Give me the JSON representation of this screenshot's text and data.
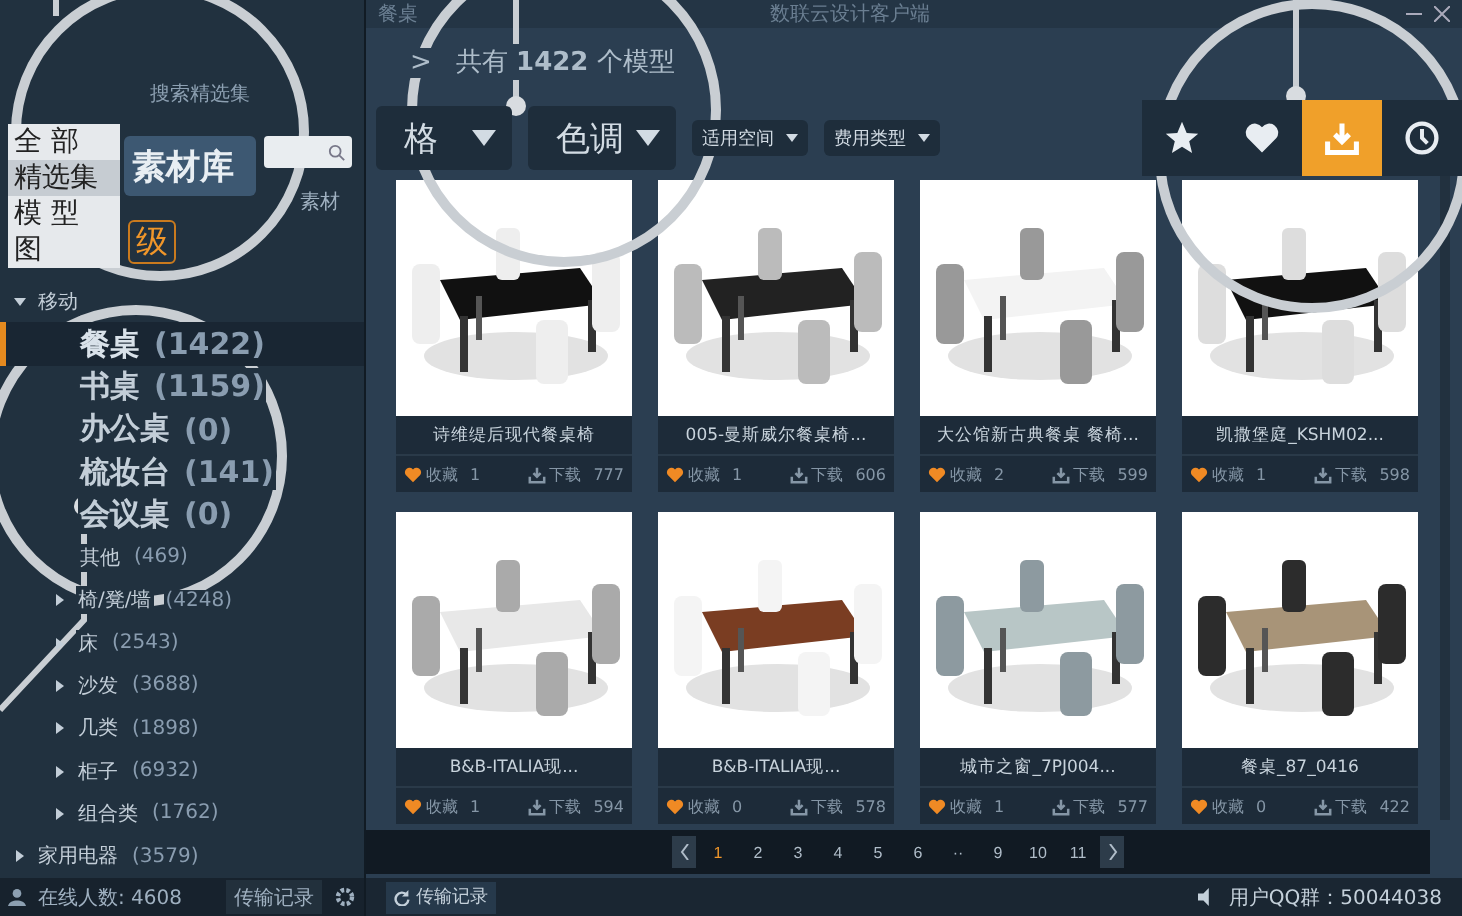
{
  "window": {
    "tab_label": "餐桌",
    "title": "数联云设计客户端"
  },
  "sidebar": {
    "search_label": "搜索精选集",
    "menu": [
      {
        "label": "全 部",
        "selected": false
      },
      {
        "label": "精选集",
        "selected": true
      },
      {
        "label": "模 型",
        "selected": false
      },
      {
        "label": "图",
        "selected": false
      }
    ],
    "library_button": "素材库",
    "tab": "素材",
    "level_badge": "级",
    "tree": [
      {
        "label": "移动",
        "expanded": true,
        "children": [
          {
            "label": "餐桌",
            "count": "(1422)",
            "selected": true,
            "magnified": true
          },
          {
            "label": "书桌",
            "count": "(1159)",
            "selected": false,
            "magnified": true
          },
          {
            "label": "办公桌",
            "count": "(0)",
            "selected": false,
            "magnified": true
          },
          {
            "label": "梳妆台",
            "count": "(141)",
            "selected": false,
            "magnified": true
          },
          {
            "label": "会议桌",
            "count": "(0)",
            "selected": false,
            "magnified": true
          },
          {
            "label": "其他",
            "count": "(469)",
            "selected": false,
            "magnified": false
          },
          {
            "label": "椅/凳/墙",
            "count": "(4248)",
            "selected": false,
            "magnified": false,
            "expanded": false
          },
          {
            "label": "床",
            "count": "(2543)",
            "selected": false,
            "magnified": false,
            "expanded": false
          },
          {
            "label": "沙发",
            "count": "(3688)",
            "selected": false,
            "magnified": false,
            "expanded": false
          },
          {
            "label": "几类",
            "count": "(1898)",
            "selected": false,
            "magnified": false,
            "expanded": false
          },
          {
            "label": "柜子",
            "count": "(6932)",
            "selected": false,
            "magnified": false,
            "expanded": false
          },
          {
            "label": "组合类",
            "count": "(1762)",
            "selected": false,
            "magnified": false,
            "expanded": false
          }
        ]
      },
      {
        "label": "家用电器",
        "count": "(3579)",
        "expanded": false
      }
    ],
    "footer": {
      "online": "在线人数: 4608",
      "transfer": "传输记录"
    }
  },
  "main": {
    "breadcrumb_arrow": ">",
    "breadcrumb": "共有 **1422** 个模型",
    "filters": [
      {
        "label": "格",
        "magnified": true
      },
      {
        "label": "色调",
        "magnified": true
      },
      {
        "label": "适用空间",
        "magnified": false
      },
      {
        "label": "费用类型",
        "magnified": false
      }
    ],
    "view_tabs": [
      {
        "kind": "star",
        "selected": false
      },
      {
        "kind": "heart",
        "selected": false
      },
      {
        "kind": "download",
        "selected": true
      },
      {
        "kind": "history",
        "selected": false
      }
    ],
    "cards": [
      {
        "title": "诗维缇后现代餐桌椅",
        "fav_label": "收藏",
        "favorites": "1",
        "dl_label": "下载",
        "downloads": "777"
      },
      {
        "title": "005-曼斯威尔餐桌椅...",
        "fav_label": "收藏",
        "favorites": "1",
        "dl_label": "下载",
        "downloads": "606"
      },
      {
        "title": "大公馆新古典餐桌 餐椅...",
        "fav_label": "收藏",
        "favorites": "2",
        "dl_label": "下载",
        "downloads": "599"
      },
      {
        "title": "凯撒堡庭_KSHM02...",
        "fav_label": "收藏",
        "favorites": "1",
        "dl_label": "下载",
        "downloads": "598"
      },
      {
        "title": "B&B-ITALIA现...",
        "fav_label": "收藏",
        "favorites": "1",
        "dl_label": "下载",
        "downloads": "594"
      },
      {
        "title": "B&B-ITALIA现...",
        "fav_label": "收藏",
        "favorites": "0",
        "dl_label": "下载",
        "downloads": "578"
      },
      {
        "title": "城市之窗_7PJ004...",
        "fav_label": "收藏",
        "favorites": "1",
        "dl_label": "下载",
        "downloads": "577"
      },
      {
        "title": "餐桌_87_0416",
        "fav_label": "收藏",
        "favorites": "0",
        "dl_label": "下载",
        "downloads": "422"
      }
    ],
    "pagination": [
      {
        "label": "1",
        "selected": true
      },
      {
        "label": "2",
        "selected": false
      },
      {
        "label": "3",
        "selected": false
      },
      {
        "label": "4",
        "selected": false
      },
      {
        "label": "5",
        "selected": false
      },
      {
        "label": "6",
        "selected": false
      },
      {
        "label": "··",
        "selected": false
      },
      {
        "label": "9",
        "selected": false
      },
      {
        "label": "10",
        "selected": false
      },
      {
        "label": "11",
        "selected": false
      }
    ]
  },
  "status_bar": {
    "transfer": "传输记录",
    "qq_group": "用户QQ群：50044038"
  }
}
